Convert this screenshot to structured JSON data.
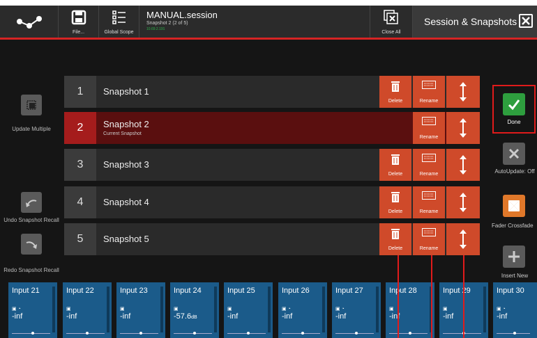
{
  "topbar": {
    "file_label": "File...",
    "scope_label": "Global Scope",
    "session_name": "MANUAL.session",
    "snapshot_sub": "Snapshot 2 (2 of 5)",
    "ip": "10.69.2.191",
    "close_all_label": "Close All",
    "panel_title": "Session & Snapshots",
    "icons": [
      "logo-icon",
      "save-icon",
      "list-icon",
      "close-all-icon",
      "close-icon"
    ]
  },
  "left": {
    "update_multiple": "Update Multiple",
    "undo_recall": "Undo Snapshot Recall",
    "redo_recall": "Redo Snapshot Recall"
  },
  "snapshots": [
    {
      "num": "1",
      "name": "Snapshot 1",
      "sub": "",
      "current": false
    },
    {
      "num": "2",
      "name": "Snapshot 2",
      "sub": "Current Snapshot",
      "current": true
    },
    {
      "num": "3",
      "name": "Snapshot 3",
      "sub": "",
      "current": false
    },
    {
      "num": "4",
      "name": "Snapshot 4",
      "sub": "",
      "current": false
    },
    {
      "num": "5",
      "name": "Snapshot 5",
      "sub": "",
      "current": false
    }
  ],
  "actions": {
    "delete": "Delete",
    "rename": "Rename"
  },
  "right": {
    "done": "Done",
    "autoupdate": "AutoUpdate: Off",
    "fader_crossfade": "Fader Crossfade",
    "insert_new": "Insert New"
  },
  "strips": [
    {
      "name": "Input 21",
      "value": "-inf",
      "unit": ""
    },
    {
      "name": "Input 22",
      "value": "-inf",
      "unit": ""
    },
    {
      "name": "Input 23",
      "value": "-inf",
      "unit": ""
    },
    {
      "name": "Input 24",
      "value": "-57.6",
      "unit": "dB"
    },
    {
      "name": "Input 25",
      "value": "-inf",
      "unit": ""
    },
    {
      "name": "Input 26",
      "value": "-inf",
      "unit": ""
    },
    {
      "name": "Input 27",
      "value": "-inf",
      "unit": ""
    },
    {
      "name": "Input 28",
      "value": "-inf",
      "unit": ""
    },
    {
      "name": "Input 29",
      "value": "-inf",
      "unit": ""
    },
    {
      "name": "Input 30",
      "value": "-inf",
      "unit": ""
    }
  ],
  "colors": {
    "accent_red": "#d62424",
    "action_orange": "#cf4a2a",
    "done_green": "#2e9e3e",
    "strip_blue": "#1b5b8a"
  }
}
